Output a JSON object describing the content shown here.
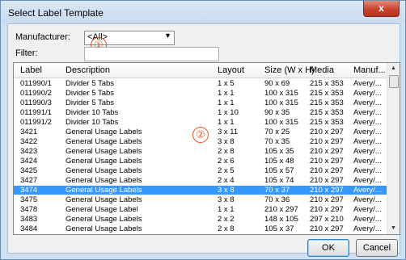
{
  "window": {
    "title": "Select Label Template",
    "close_glyph": "x"
  },
  "form": {
    "manufacturer_label": "Manufacturer:",
    "manufacturer_value": "<All>",
    "filter_label": "Filter:",
    "filter_value": ""
  },
  "markers": {
    "one": "①",
    "two": "②",
    "color": "#e05a2a"
  },
  "table": {
    "columns": [
      "Label",
      "Description",
      "Layout",
      "Size (W x H)",
      "Media",
      "Manuf..."
    ],
    "rows": [
      [
        "011990/1",
        "Divider  5 Tabs",
        "1 x 5",
        "90 x 69",
        "215 x 353",
        "Avery/..."
      ],
      [
        "011990/2",
        "Divider  5 Tabs",
        "1 x 1",
        "100 x 315",
        "215 x 353",
        "Avery/..."
      ],
      [
        "011990/3",
        "Divider  5 Tabs",
        "1 x 1",
        "100 x 315",
        "215 x 353",
        "Avery/..."
      ],
      [
        "011991/1",
        "Divider 10 Tabs",
        "1 x 10",
        "90 x 35",
        "215 x 353",
        "Avery/..."
      ],
      [
        "011991/2",
        "Divider 10 Tabs",
        "1 x 1",
        "100 x 315",
        "215 x 353",
        "Avery/..."
      ],
      [
        "3421",
        "General Usage Labels",
        "3 x 11",
        "70 x 25",
        "210 x 297",
        "Avery/..."
      ],
      [
        "3422",
        "General Usage Labels",
        "3 x 8",
        "70 x 35",
        "210 x 297",
        "Avery/..."
      ],
      [
        "3423",
        "General Usage Labels",
        "2 x 8",
        "105 x 35",
        "210 x 297",
        "Avery/..."
      ],
      [
        "3424",
        "General Usage Labels",
        "2 x 6",
        "105 x 48",
        "210 x 297",
        "Avery/..."
      ],
      [
        "3425",
        "General Usage Labels",
        "2 x 5",
        "105 x 57",
        "210 x 297",
        "Avery/..."
      ],
      [
        "3427",
        "General Usage Labels",
        "2 x 4",
        "105 x 74",
        "210 x 297",
        "Avery/..."
      ],
      [
        "3474",
        "General Usage Labels",
        "3 x 8",
        "70 x 37",
        "210 x 297",
        "Avery/..."
      ],
      [
        "3475",
        "General Usage Labels",
        "3 x 8",
        "70 x 36",
        "210 x 297",
        "Avery/..."
      ],
      [
        "3478",
        "General Usage Label",
        "1 x 1",
        "210 x 297",
        "210 x 297",
        "Avery/..."
      ],
      [
        "3483",
        "General Usage Labels",
        "2 x 2",
        "148 x 105",
        "297 x 210",
        "Avery/..."
      ],
      [
        "3484",
        "General Usage Labels",
        "2 x 8",
        "105 x 37",
        "210 x 297",
        "Avery/..."
      ]
    ],
    "selected_label": "3474",
    "selection_color": "#3399ff"
  },
  "buttons": {
    "ok": "OK",
    "cancel": "Cancel"
  }
}
